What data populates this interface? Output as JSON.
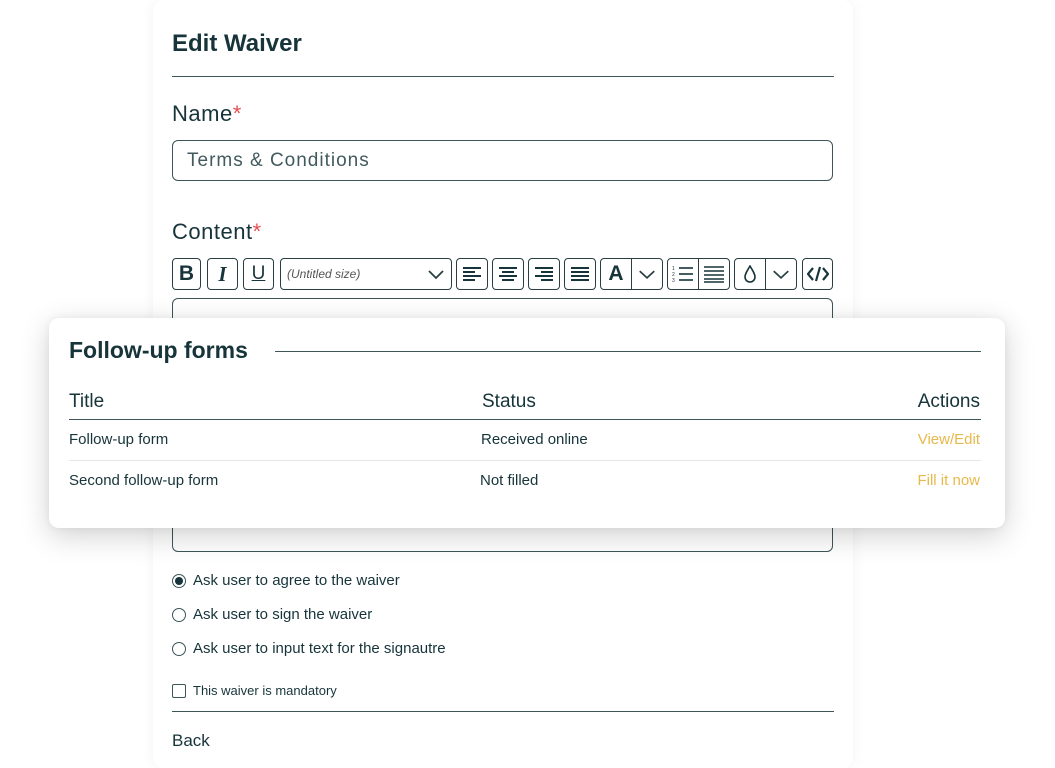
{
  "form": {
    "title": "Edit Waiver",
    "name_label": "Name",
    "name_value": "Terms & Conditions",
    "required_mark": "*",
    "content_label": "Content",
    "toolbar": {
      "bold": "B",
      "italic": "I",
      "underline": "U",
      "font_size": "(Untitled size)",
      "font_color_glyph": "A"
    },
    "options": [
      {
        "label": "Ask user to agree to the waiver",
        "checked": true
      },
      {
        "label": "Ask user to sign the waiver",
        "checked": false
      },
      {
        "label": "Ask user to input text for the signautre",
        "checked": false
      }
    ],
    "mandatory_label": "This waiver is mandatory",
    "mandatory_checked": false,
    "back_label": "Back"
  },
  "followup": {
    "title": "Follow-up forms",
    "columns": [
      "Title",
      "Status",
      "Actions"
    ],
    "rows": [
      {
        "title": "Follow-up form",
        "status": "Received online",
        "action": "View/Edit"
      },
      {
        "title": "Second follow-up form",
        "status": "Not filled",
        "action": "Fill it now"
      }
    ]
  },
  "colors": {
    "text": "#16343a",
    "required": "#e05050",
    "action": "#e8b84a"
  }
}
